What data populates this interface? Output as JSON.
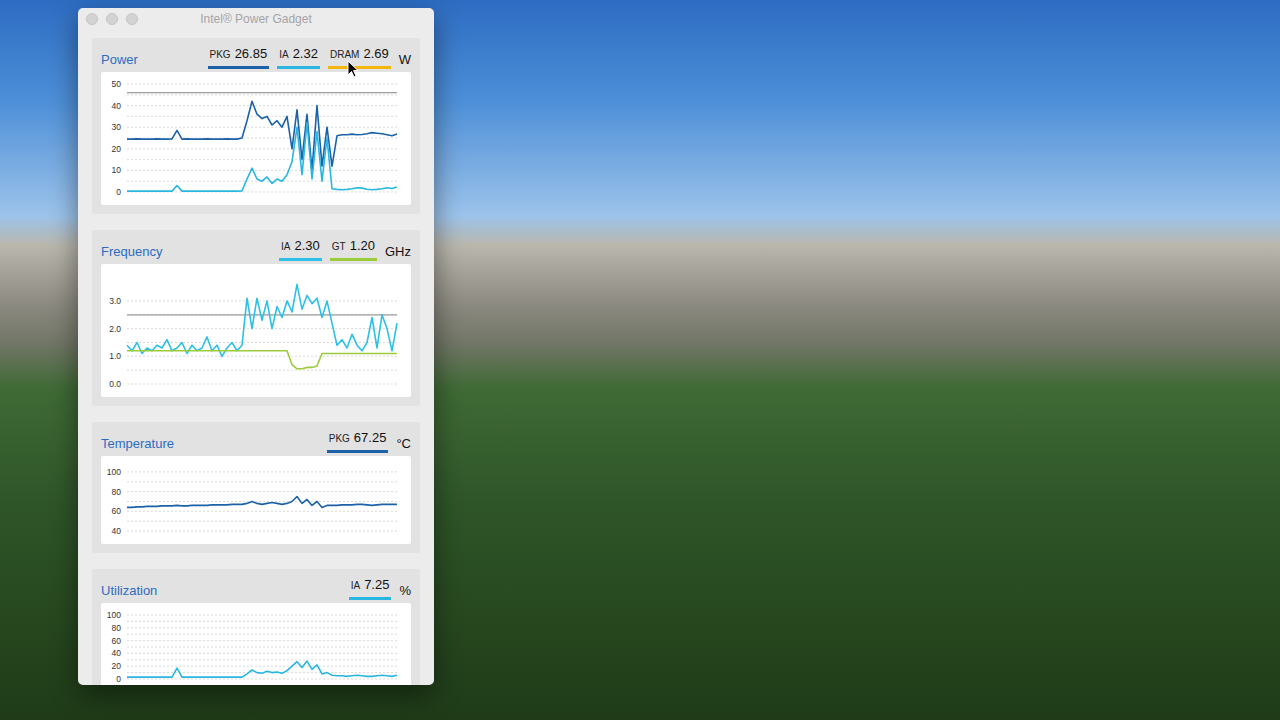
{
  "window": {
    "title": "Intel® Power Gadget"
  },
  "panels": [
    {
      "title": "Power",
      "unit": "W",
      "readouts": [
        {
          "label": "PKG",
          "value": "26.85",
          "color": "#1b62a8"
        },
        {
          "label": "IA",
          "value": "2.32",
          "color": "#29b6e0"
        },
        {
          "label": "DRAM",
          "value": "2.69",
          "color": "#f2b70a"
        }
      ],
      "chart": {
        "min": 0,
        "max": 50,
        "ticks": [
          "50",
          "40",
          "30",
          "20",
          "10",
          "0"
        ],
        "guides": [
          46
        ],
        "series": [
          {
            "color": "#1b62a8",
            "values": [
              24.5,
              24.5,
              24.6,
              24.5,
              24.5,
              24.5,
              24.6,
              24.5,
              24.5,
              24.6,
              28.5,
              24.5,
              24.6,
              24.5,
              24.5,
              24.5,
              24.6,
              24.5,
              24.5,
              24.5,
              24.6,
              24.5,
              24.5,
              25,
              33,
              42,
              36,
              34,
              35,
              31,
              33,
              30,
              35,
              20,
              38,
              15,
              36,
              10,
              40,
              12,
              30,
              12,
              26,
              26.5,
              26.5,
              26.8,
              26.5,
              26.6,
              27,
              27.5,
              27.2,
              27,
              26.5,
              26,
              26.8
            ]
          },
          {
            "color": "#29b6e0",
            "values": [
              0.4,
              0.4,
              0.4,
              0.4,
              0.4,
              0.4,
              0.4,
              0.4,
              0.4,
              0.4,
              3,
              0.4,
              0.4,
              0.4,
              0.4,
              0.4,
              0.4,
              0.4,
              0.4,
              0.4,
              0.4,
              0.4,
              0.4,
              0.5,
              6,
              11,
              6,
              5,
              7,
              4,
              6,
              5,
              8,
              14,
              30,
              8,
              32,
              6,
              28,
              5,
              25,
              1.5,
              1.2,
              1,
              1.2,
              1.5,
              2,
              1.8,
              1.3,
              1,
              1.2,
              1.5,
              2,
              1.6,
              2.3
            ]
          }
        ]
      }
    },
    {
      "title": "Frequency",
      "unit": "GHz",
      "readouts": [
        {
          "label": "IA",
          "value": "2.30",
          "color": "#2ec0e6"
        },
        {
          "label": "GT",
          "value": "1.20",
          "color": "#9ccc3a"
        }
      ],
      "chart": {
        "min": 0,
        "max": 3.9,
        "ticks": [
          "3.0",
          "2.0",
          "1.0",
          "0.0"
        ],
        "guides": [
          2.5
        ],
        "series": [
          {
            "color": "#2ec0e6",
            "values": [
              1.4,
              1.2,
              1.5,
              1.1,
              1.3,
              1.2,
              1.4,
              1.3,
              1.6,
              1.2,
              1.3,
              1.5,
              1.1,
              1.4,
              1.2,
              1.3,
              1.7,
              1.2,
              1.4,
              1.0,
              1.3,
              1.5,
              1.2,
              1.4,
              3.1,
              2.0,
              3.1,
              2.3,
              3.0,
              2.0,
              2.8,
              2.4,
              3.0,
              2.6,
              3.6,
              2.7,
              3.2,
              2.9,
              3.1,
              2.4,
              3.0,
              2.2,
              1.4,
              1.6,
              1.3,
              1.8,
              1.4,
              1.2,
              1.5,
              2.4,
              1.3,
              2.5,
              2.0,
              1.2,
              2.2
            ]
          },
          {
            "color": "#9ccc3a",
            "values": [
              1.2,
              1.2,
              1.2,
              1.2,
              1.2,
              1.2,
              1.2,
              1.2,
              1.2,
              1.2,
              1.2,
              1.2,
              1.2,
              1.2,
              1.2,
              1.2,
              1.2,
              1.2,
              1.2,
              1.2,
              1.2,
              1.2,
              1.2,
              1.2,
              1.2,
              1.2,
              1.2,
              1.2,
              1.2,
              1.2,
              1.2,
              1.2,
              1.2,
              0.7,
              0.55,
              0.55,
              0.6,
              0.6,
              0.65,
              1.1,
              1.1,
              1.1,
              1.1,
              1.1,
              1.1,
              1.1,
              1.1,
              1.1,
              1.1,
              1.1,
              1.1,
              1.1,
              1.1,
              1.1,
              1.1
            ]
          }
        ]
      }
    },
    {
      "title": "Temperature",
      "unit": "°C",
      "readouts": [
        {
          "label": "PKG",
          "value": "67.25",
          "color": "#1b62a8"
        }
      ],
      "chart": {
        "min": 40,
        "max": 104,
        "ticks": [
          "100",
          "80",
          "60",
          "40"
        ],
        "guides": [],
        "series": [
          {
            "color": "#1b62a8",
            "values": [
              64,
              64,
              64.5,
              64.5,
              65,
              65,
              65,
              65.5,
              65.5,
              65.5,
              66,
              65.5,
              65.5,
              66,
              66,
              66,
              66,
              66.5,
              66.5,
              66.5,
              66.5,
              67,
              67,
              67,
              68,
              70,
              68,
              67,
              68,
              69,
              68,
              67,
              68,
              70,
              75,
              68,
              72,
              66,
              70,
              64,
              66,
              66,
              66,
              66.5,
              66.5,
              66.5,
              67,
              67,
              66.5,
              66,
              66.5,
              67,
              67,
              67,
              67
            ]
          }
        ]
      }
    },
    {
      "title": "Utilization",
      "unit": "%",
      "readouts": [
        {
          "label": "IA",
          "value": "7.25",
          "color": "#29b6e0"
        }
      ],
      "chart": {
        "min": 0,
        "max": 100,
        "ticks": [
          "100",
          "80",
          "60",
          "40",
          "20",
          "0"
        ],
        "guides": [],
        "series": [
          {
            "color": "#29b6e0",
            "values": [
              3,
              3,
              3,
              3,
              3,
              3,
              3,
              3,
              3,
              3,
              17,
              3,
              3,
              3,
              3,
              3,
              3,
              3,
              3,
              3,
              3,
              3,
              3,
              3,
              8,
              14,
              10,
              9,
              12,
              10,
              11,
              9,
              13,
              20,
              27,
              18,
              28,
              15,
              22,
              8,
              10,
              6,
              5,
              5,
              4,
              5,
              6,
              5,
              4,
              4,
              5,
              6,
              5,
              4,
              6
            ]
          }
        ]
      }
    }
  ]
}
